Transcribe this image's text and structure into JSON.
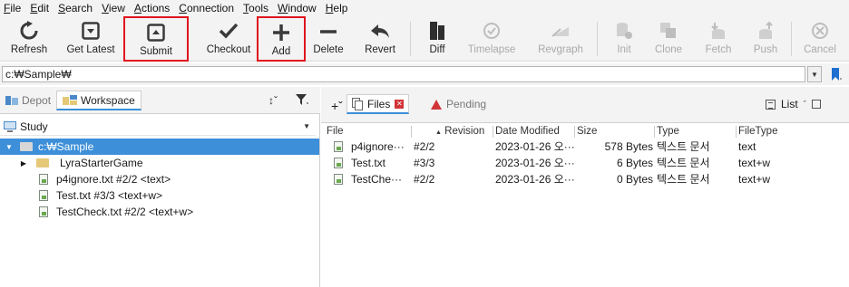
{
  "menu": {
    "items": [
      {
        "u": "F",
        "rest": "ile"
      },
      {
        "u": "E",
        "rest": "dit"
      },
      {
        "u": "S",
        "rest": "earch"
      },
      {
        "u": "V",
        "rest": "iew"
      },
      {
        "u": "A",
        "rest": "ctions"
      },
      {
        "u": "C",
        "rest": "onnection"
      },
      {
        "u": "T",
        "rest": "ools"
      },
      {
        "u": "W",
        "rest": "indow"
      },
      {
        "u": "H",
        "rest": "elp"
      }
    ]
  },
  "toolbar": {
    "refresh": "Refresh",
    "get_latest": "Get Latest",
    "submit": "Submit",
    "checkout": "Checkout",
    "add": "Add",
    "delete": "Delete",
    "revert": "Revert",
    "diff": "Diff",
    "timelapse": "Timelapse",
    "revgraph": "Revgraph",
    "init": "Init",
    "clone": "Clone",
    "fetch": "Fetch",
    "push": "Push",
    "cancel": "Cancel"
  },
  "path_bar": {
    "value": "c:₩Sample₩"
  },
  "left_panel": {
    "tab_depot": "Depot",
    "tab_workspace": "Workspace",
    "workspace_combo": "Study",
    "tree": {
      "root": "c:₩Sample",
      "folder": "LyraStarterGame",
      "files": [
        "p4ignore.txt #2/2 <text>",
        "Test.txt #3/3 <text+w>",
        "TestCheck.txt #2/2 <text+w>"
      ]
    }
  },
  "right_panel": {
    "tab_files": "Files",
    "tab_pending": "Pending",
    "view_mode": "List",
    "columns": [
      "File",
      "Revision",
      "Date Modified",
      "Size",
      "Type",
      "FileType"
    ],
    "rows": [
      {
        "file": "p4ignore···",
        "rev": "#2/2",
        "date": "2023-01-26 오···",
        "size": "578 Bytes",
        "type": "텍스트 문서",
        "filetype": "text"
      },
      {
        "file": "Test.txt",
        "rev": "#3/3",
        "date": "2023-01-26 오···",
        "size": "6 Bytes",
        "type": "텍스트 문서",
        "filetype": "text+w"
      },
      {
        "file": "TestChe···",
        "rev": "#2/2",
        "date": "2023-01-26 오···",
        "size": "0 Bytes",
        "type": "텍스트 문서",
        "filetype": "text+w"
      }
    ]
  },
  "colors": {
    "highlight_box": "#e0141e",
    "selection": "#3d8fd9",
    "pending_marker": "#d13438"
  }
}
